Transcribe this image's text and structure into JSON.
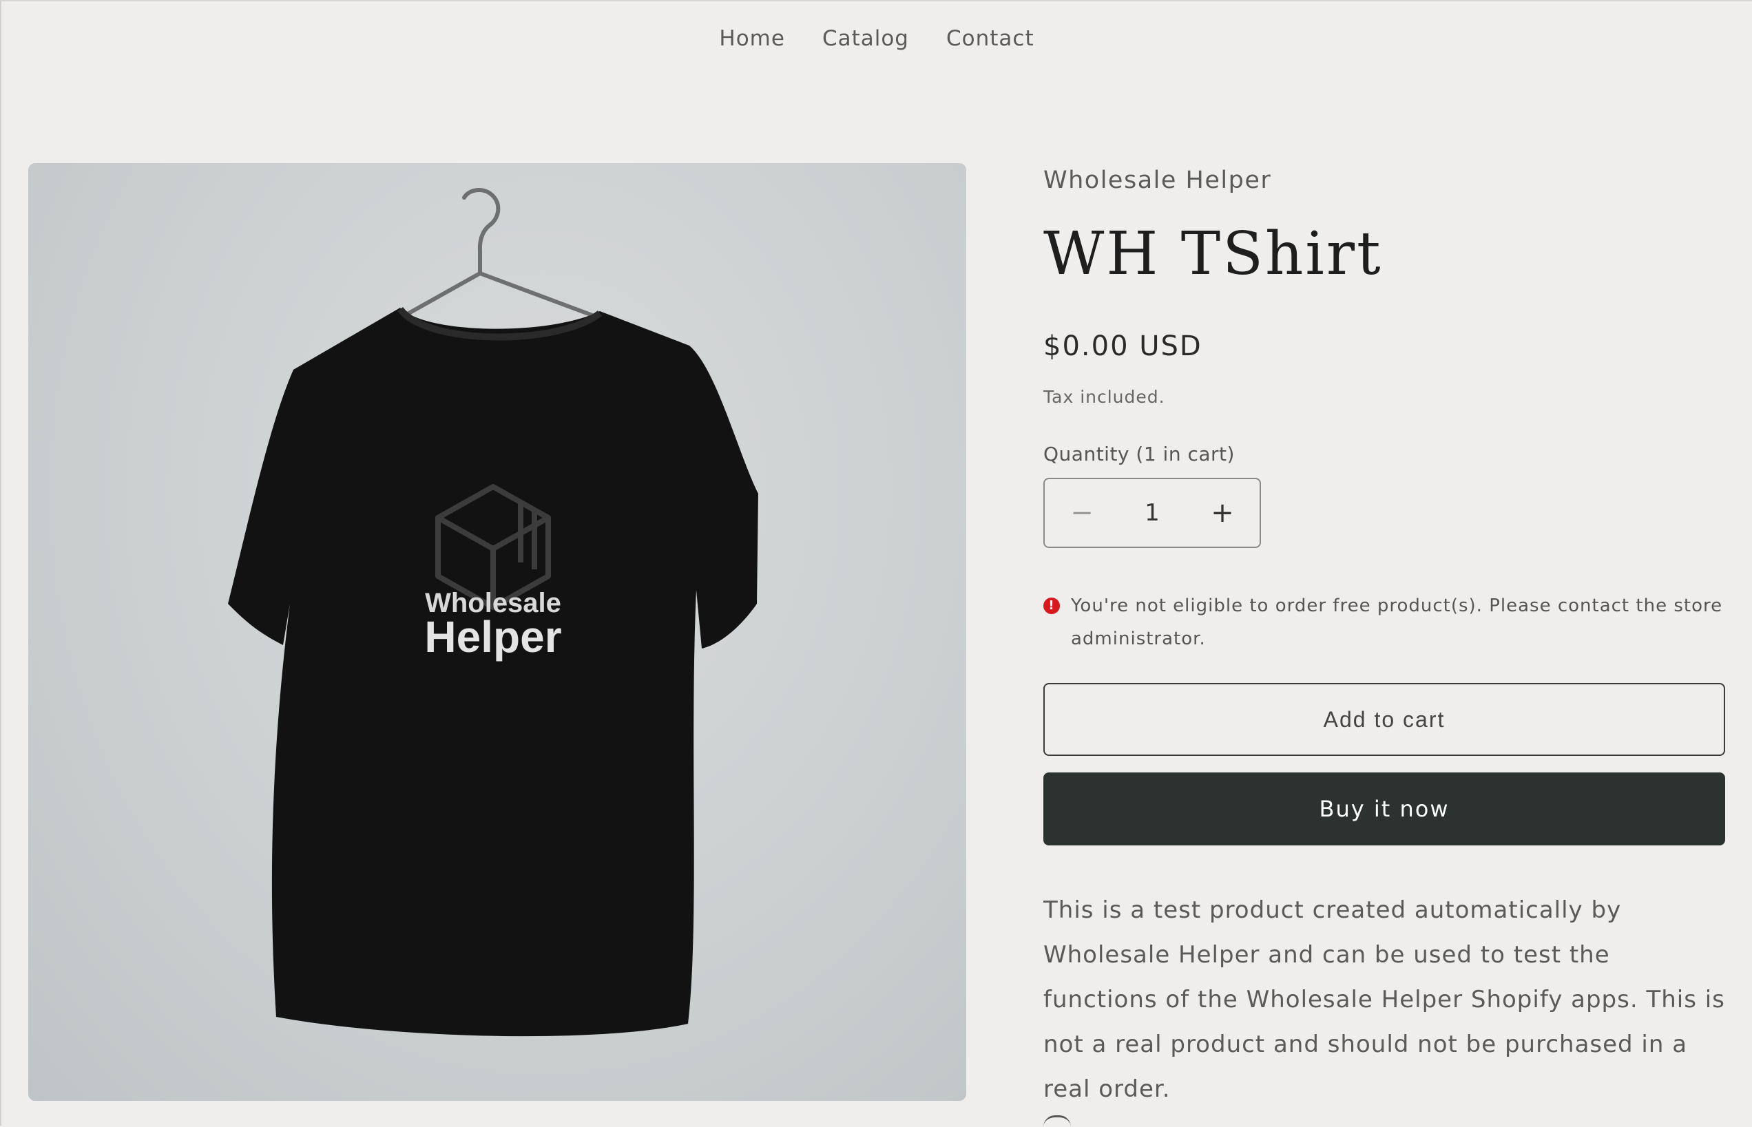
{
  "nav": {
    "items": [
      {
        "label": "Home"
      },
      {
        "label": "Catalog"
      },
      {
        "label": "Contact"
      }
    ]
  },
  "product": {
    "vendor": "Wholesale Helper",
    "title": "WH TShirt",
    "price": "$0.00 USD",
    "tax_note": "Tax included.",
    "image_logo_text": [
      "Wholesale",
      "Helper"
    ],
    "quantity": {
      "label": "Quantity (1 in cart)",
      "value": "1",
      "decrement_symbol": "−",
      "increment_symbol": "+"
    },
    "error": {
      "icon": "error-icon",
      "symbol": "!",
      "message": "You're not eligible to order free product(s). Please contact the store administrator."
    },
    "add_to_cart_label": "Add to cart",
    "buy_now_label": "Buy it now",
    "description": "This is a test product created automatically by Wholesale Helper and can be used to test the functions of the Wholesale Helper Shopify apps. This is not a real product and should not be purchased in a real order."
  },
  "colors": {
    "background": "#efeeec",
    "buy_button": "#2b3230",
    "error_red": "#d6191f",
    "text_dark": "#1e1e1e"
  }
}
